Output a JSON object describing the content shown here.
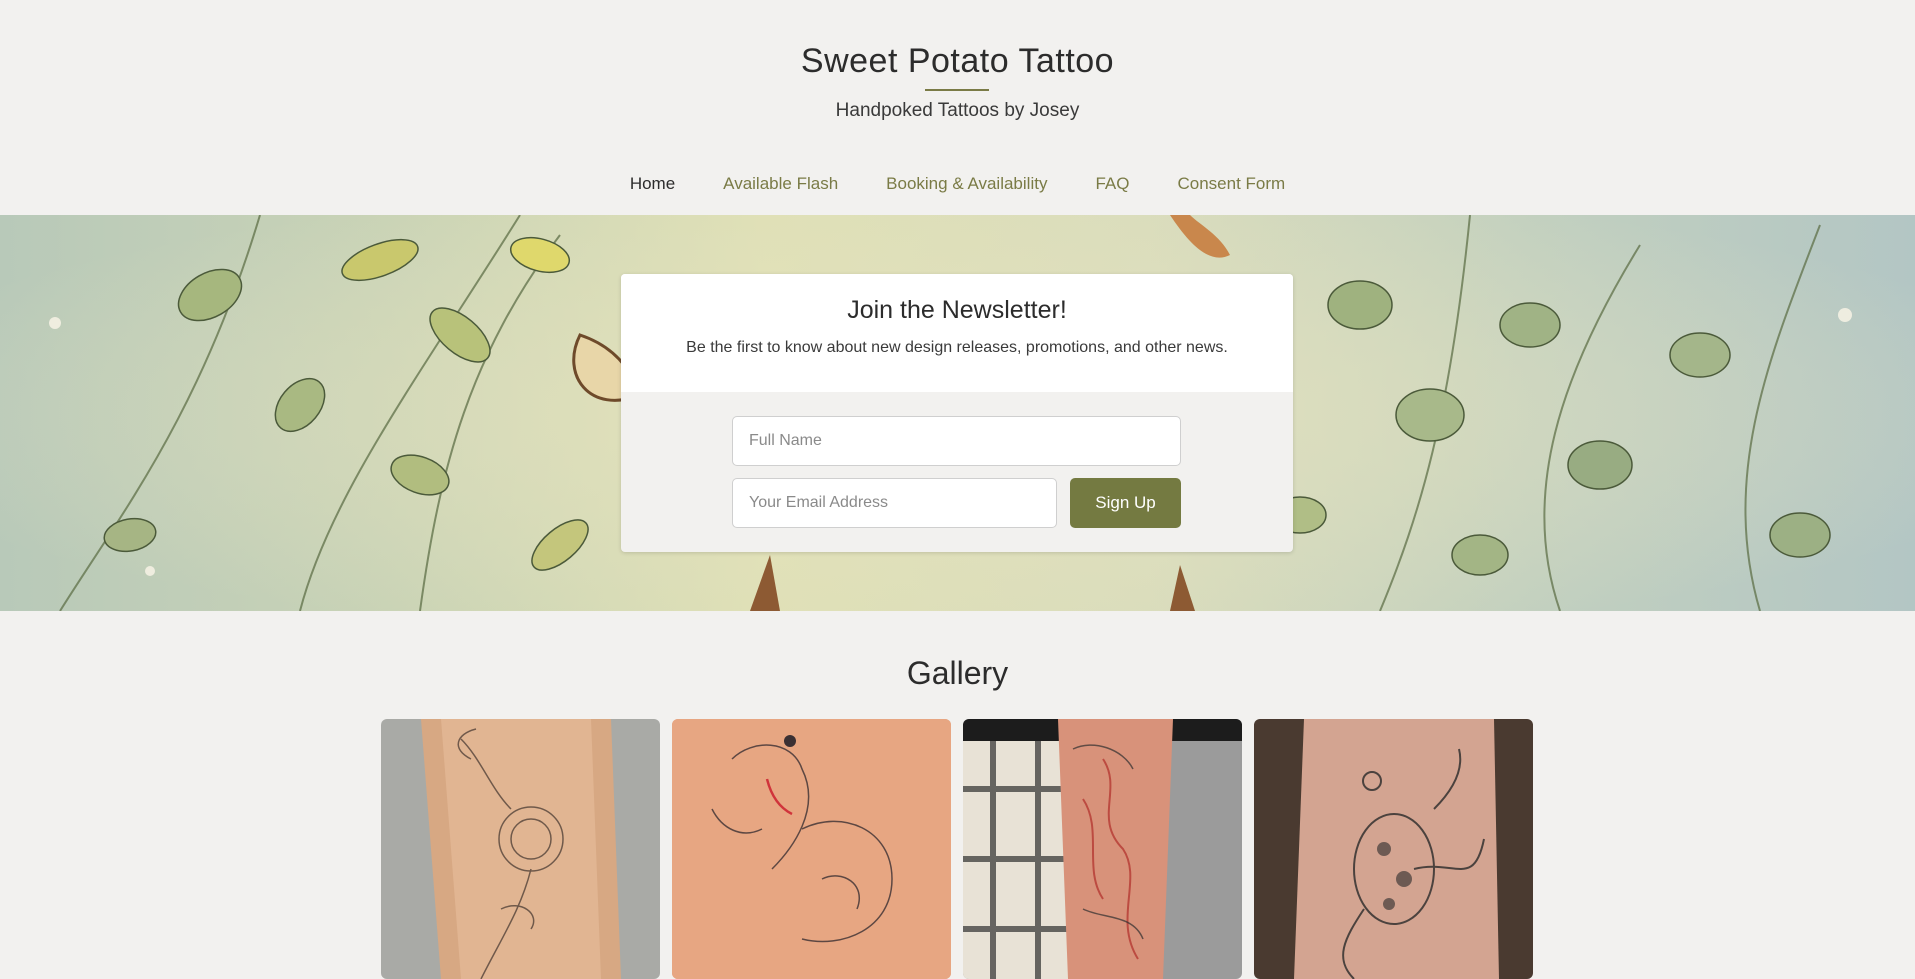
{
  "site": {
    "title": "Sweet Potato Tattoo",
    "tagline": "Handpoked Tattoos by Josey",
    "accent_color": "#7a7b46"
  },
  "nav": {
    "items": [
      {
        "label": "Home",
        "active": true
      },
      {
        "label": "Available Flash",
        "active": false
      },
      {
        "label": "Booking & Availability",
        "active": false
      },
      {
        "label": "FAQ",
        "active": false
      },
      {
        "label": "Consent Form",
        "active": false
      }
    ]
  },
  "newsletter": {
    "title": "Join the Newsletter!",
    "description": "Be the first to know about new design releases, promotions, and other news.",
    "name_placeholder": "Full Name",
    "email_placeholder": "Your Email Address",
    "button_label": "Sign Up",
    "button_color": "#747a41"
  },
  "gallery": {
    "title": "Gallery",
    "items": [
      {
        "name": "floral-forearm-tattoo"
      },
      {
        "name": "fox-tattoo"
      },
      {
        "name": "dragon-sleeve-tattoo"
      },
      {
        "name": "frog-tattoo"
      }
    ]
  }
}
